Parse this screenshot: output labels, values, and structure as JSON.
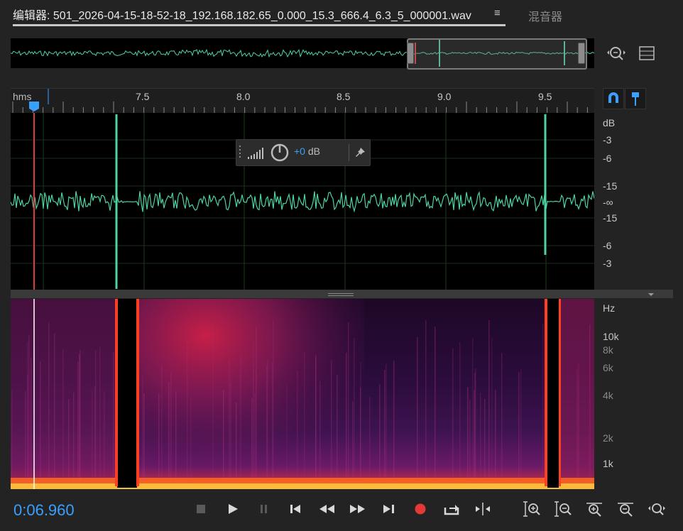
{
  "tabs": {
    "editor_label": "编辑器: 501_2026-04-15-18-52-18_192.168.182.65_0.000_15.3_666.4_6.3_5_000001.wav",
    "menu_icon": "≡",
    "mixer_label": "混音器"
  },
  "ruler": {
    "unit": "hms",
    "ticks": [
      "7.5",
      "8.0",
      "8.5",
      "9.0",
      "9.5"
    ]
  },
  "db_scale": [
    "dB",
    "-3",
    "-6",
    "-15",
    "-∞",
    "-15",
    "-6",
    "-3"
  ],
  "hz_scale": [
    "Hz",
    "10k",
    "8k",
    "6k",
    "4k",
    "2k",
    "1k"
  ],
  "hud": {
    "amount": "+0",
    "unit": "dB"
  },
  "transport": {
    "time": "0:06.960"
  },
  "colors": {
    "waveform": "#4fd3a0",
    "playhead": "#e03a3a",
    "accent": "#3aa0ff",
    "record": "#e53935"
  },
  "icons": {
    "overview": [
      "zoom-navigator-icon",
      "list-icon"
    ],
    "ruler": [
      "snap-magnet-icon",
      "marker-icon"
    ],
    "transport": [
      "stop-icon",
      "play-icon",
      "pause-icon",
      "go-to-start-icon",
      "rewind-icon",
      "fast-forward-icon",
      "go-to-end-icon",
      "record-icon",
      "loop-playback-icon",
      "skip-selection-icon"
    ],
    "zoom": [
      "zoom-in-amplitude-icon",
      "zoom-out-amplitude-icon",
      "zoom-in-time-icon",
      "zoom-out-time-icon",
      "zoom-selection-icon"
    ]
  }
}
